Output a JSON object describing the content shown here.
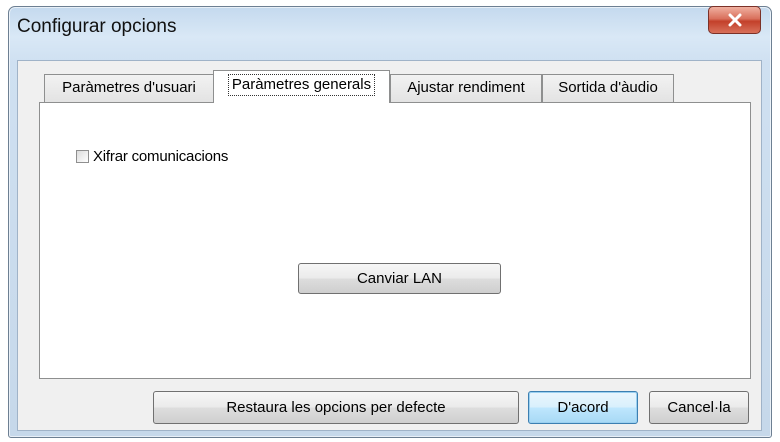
{
  "window": {
    "title": "Configurar opcions"
  },
  "tabs": [
    {
      "label": "Paràmetres d'usuari"
    },
    {
      "label": "Paràmetres generals"
    },
    {
      "label": "Ajustar rendiment"
    },
    {
      "label": "Sortida d'àudio"
    }
  ],
  "active_tab": "Paràmetres generals",
  "panel": {
    "encrypt_checkbox": {
      "label": "Xifrar comunicacions",
      "checked": false
    },
    "change_lan_button": "Canviar LAN"
  },
  "footer": {
    "restore_button": "Restaura les opcions per defecte",
    "ok_button": "D'acord",
    "cancel_button": "Cancel·la"
  },
  "icons": {
    "close": "close-icon"
  },
  "colors": {
    "close_button": "#c3402a",
    "default_button_border": "#3c7fb1"
  }
}
